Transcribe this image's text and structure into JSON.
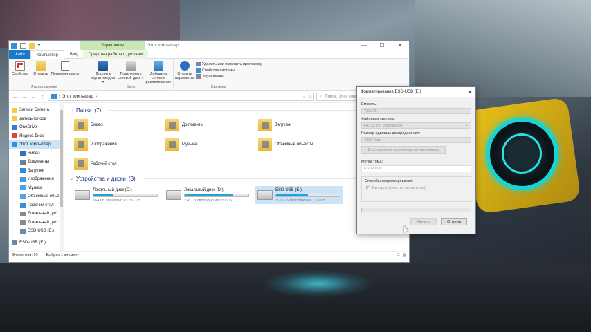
{
  "window": {
    "title": "Этот компьютер",
    "ctx_tab_header": "Управление",
    "controls": [
      "—",
      "☐",
      "✕"
    ]
  },
  "ribbon_tabs": {
    "file": "Файл",
    "computer": "Компьютер",
    "view": "Вид",
    "drive_tools": "Средства работы с дисками"
  },
  "ribbon": {
    "location": {
      "label": "Расположение",
      "buttons": [
        "Свойства",
        "Открыть",
        "Переименовать"
      ]
    },
    "network": {
      "label": "Сеть",
      "buttons": [
        "Доступ к мультимедиа ▾",
        "Подключить сетевой диск ▾",
        "Добавить сетевое расположение"
      ]
    },
    "system": {
      "label": "Система",
      "open_params": "Открыть параметры",
      "small": [
        "Удалить или изменить программу",
        "Свойства системы",
        "Управление"
      ]
    }
  },
  "address": {
    "path": [
      "Этот компьютер",
      "›"
    ],
    "search_placeholder": "Поиск: Этот компьютер",
    "nav": [
      "←",
      "→",
      "↑"
    ]
  },
  "nav": {
    "items": [
      {
        "label": "Записи Camera",
        "sub": false
      },
      {
        "label": "запись голоса",
        "sub": false
      },
      {
        "label": "OneDrive",
        "sub": false
      },
      {
        "label": "Яндекс.Диск",
        "sub": false
      },
      {
        "label": "Этот компьютер",
        "sub": false
      },
      {
        "label": "Видео",
        "sub": true
      },
      {
        "label": "Документы",
        "sub": true
      },
      {
        "label": "Загрузки",
        "sub": true
      },
      {
        "label": "Изображения",
        "sub": true
      },
      {
        "label": "Музыка",
        "sub": true
      },
      {
        "label": "Объемные объе",
        "sub": true
      },
      {
        "label": "Рабочий стол",
        "sub": true
      },
      {
        "label": "Локальный дис",
        "sub": true
      },
      {
        "label": "Локальный дис",
        "sub": true
      },
      {
        "label": "ESD-USB (E:)",
        "sub": true
      },
      {
        "label": "ESD-USB (E:)",
        "sub": false
      }
    ]
  },
  "folders_section": {
    "title": "Папки",
    "count": "(7)"
  },
  "folders": [
    "Видео",
    "Документы",
    "Загрузки",
    "Изображения",
    "Музыка",
    "Объемные объекты",
    "Рабочий стол"
  ],
  "drives_section": {
    "title": "Устройства и диски",
    "count": "(3)"
  },
  "drives": [
    {
      "name": "Локальный диск (C:)",
      "free": "164 ГБ свободно из 237 ГБ",
      "used_pct": 31
    },
    {
      "name": "Локальный диск (D:)",
      "free": "226 ГБ свободно из 931 ГБ",
      "used_pct": 76
    },
    {
      "name": "ESD-USB (E:)",
      "free": "3,78 ГБ свободно из 7,60 ГБ",
      "used_pct": 50
    }
  ],
  "status": {
    "items": "Элементов: 10",
    "selected": "Выбран 1 элемент"
  },
  "dialog": {
    "title": "Форматирование ESD-USB (E:)",
    "capacity_label": "Емкость:",
    "capacity_value": "7,61 ГБ",
    "fs_label": "Файловая система:",
    "fs_value": "FAT32 (по умолчанию)",
    "unit_label": "Размер единицы распределения:",
    "unit_value": "4096 байт",
    "restore_btn": "Восстановить параметры по умолчанию",
    "volume_label": "Метка тома:",
    "volume_value": "ESD-USB",
    "methods_label": "Способы форматирования:",
    "quick_label": "Быстрое (очистка оглавления)",
    "start": "Начать",
    "cancel": "Отмена"
  }
}
